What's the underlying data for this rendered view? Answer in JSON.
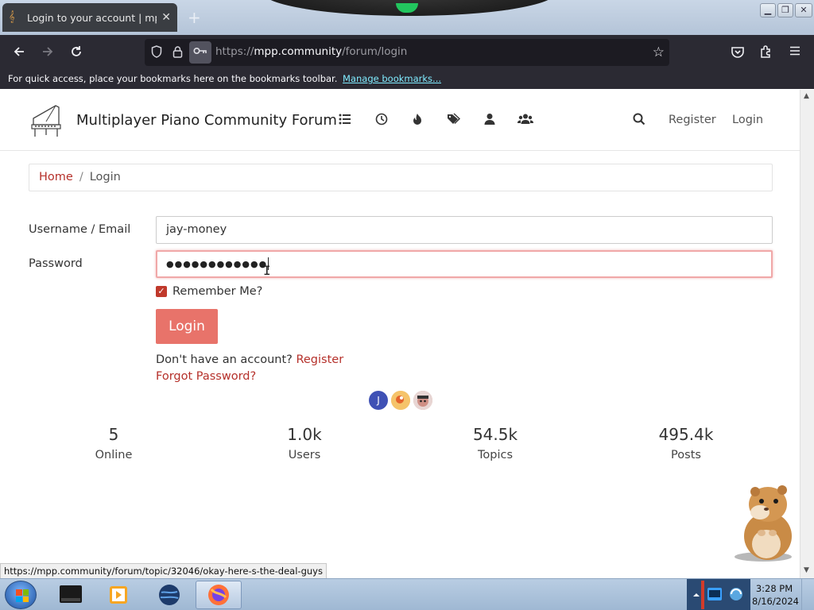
{
  "browser": {
    "tab_title": "Login to your account | mpp.co",
    "tab_close": "✕",
    "new_tab": "+",
    "url_scheme": "https://",
    "url_host": "mpp.community",
    "url_path": "/forum/login",
    "bookmarks_text": "For quick access, place your bookmarks here on the bookmarks toolbar.",
    "bookmarks_link": "Manage bookmarks..."
  },
  "header": {
    "site_title": "Multiplayer Piano Community Forum",
    "nav_icons": [
      "categories-icon",
      "recent-icon",
      "popular-icon",
      "tags-icon",
      "users-icon",
      "groups-icon"
    ],
    "register_label": "Register",
    "login_label": "Login"
  },
  "breadcrumb": {
    "home": "Home",
    "separator": "/",
    "current": "Login"
  },
  "form": {
    "username_label": "Username / Email",
    "username_value": "jay-money",
    "password_label": "Password",
    "password_masked": "●●●●●●●●●●●●",
    "remember_label": "Remember Me?",
    "remember_checked": true,
    "login_button": "Login",
    "no_account_text": "Don't have an account?",
    "register_link": "Register",
    "forgot_link": "Forgot Password?"
  },
  "online_avatars": [
    {
      "initial": "J",
      "color": "#3f51b5"
    },
    {
      "initial": "",
      "color": "#f5c36a"
    },
    {
      "initial": "",
      "color": "#cf9a90"
    }
  ],
  "stats": [
    {
      "value": "5",
      "label": "Online"
    },
    {
      "value": "1.0k",
      "label": "Users"
    },
    {
      "value": "54.5k",
      "label": "Topics"
    },
    {
      "value": "495.4k",
      "label": "Posts"
    }
  ],
  "status_url": "https://mpp.community/forum/topic/32046/okay-here-s-the-deal-guys",
  "taskbar": {
    "time": "3:28 PM",
    "date": "8/16/2024"
  },
  "colors": {
    "accent": "#b5302a",
    "login_button": "#e8736a",
    "checkbox": "#c0392b",
    "browser_dark": "#2b2a33"
  }
}
